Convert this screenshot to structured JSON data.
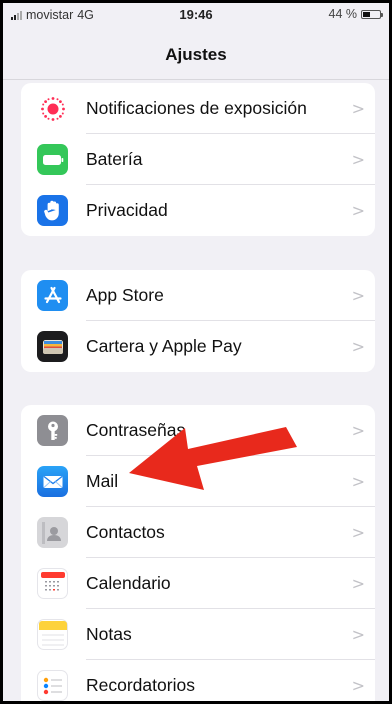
{
  "status_bar": {
    "carrier": "movistar",
    "network": "4G",
    "time": "19:46",
    "battery": "44 %",
    "battery_level": 0.44
  },
  "nav": {
    "title": "Ajustes"
  },
  "groups": [
    {
      "items": [
        {
          "label": "Notificaciones de exposición",
          "icon": "exposure-icon",
          "color": "#ffffff"
        },
        {
          "label": "Batería",
          "icon": "battery-icon",
          "color": "#34c759"
        },
        {
          "label": "Privacidad",
          "icon": "hand-icon",
          "color": "#1a73e8"
        }
      ]
    },
    {
      "items": [
        {
          "label": "App Store",
          "icon": "app-store-icon",
          "color": "#1f8ef1"
        },
        {
          "label": "Cartera y Apple Pay",
          "icon": "wallet-icon",
          "color": "#1c1c1e"
        }
      ]
    },
    {
      "items": [
        {
          "label": "Contraseñas",
          "icon": "key-icon",
          "color": "#8e8e93"
        },
        {
          "label": "Mail",
          "icon": "mail-icon",
          "color": "#1e88f0"
        },
        {
          "label": "Contactos",
          "icon": "contacts-icon",
          "color": "#cfcfd2"
        },
        {
          "label": "Calendario",
          "icon": "calendar-icon",
          "color": "#ffffff"
        },
        {
          "label": "Notas",
          "icon": "notes-icon",
          "color": "#ffffff"
        },
        {
          "label": "Recordatorios",
          "icon": "reminders-icon",
          "color": "#ffffff"
        }
      ]
    }
  ],
  "chevron": ">",
  "accent_arrow_color": "#e8291c"
}
